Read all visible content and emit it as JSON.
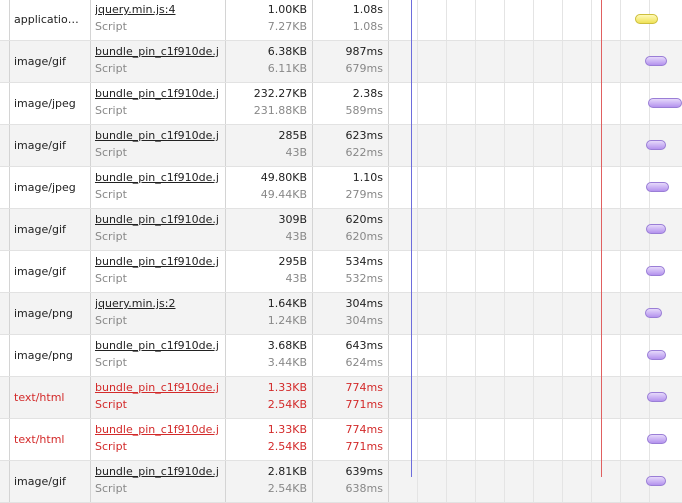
{
  "rows": [
    {
      "type": "applicatio…",
      "initiator": "jquery.min.js:4",
      "initiator_kind": "Script",
      "size": "1.00KB",
      "content": "7.27KB",
      "time": "1.08s",
      "latency": "1.08s",
      "status": "ok",
      "bar_color": "yellow"
    },
    {
      "type": "image/gif",
      "initiator": "bundle_pin_c1f910de.j",
      "initiator_kind": "Script",
      "size": "6.38KB",
      "content": "6.11KB",
      "time": "987ms",
      "latency": "679ms",
      "status": "ok",
      "bar_color": "purple"
    },
    {
      "type": "image/jpeg",
      "initiator": "bundle_pin_c1f910de.j",
      "initiator_kind": "Script",
      "size": "232.27KB",
      "content": "231.88KB",
      "time": "2.38s",
      "latency": "589ms",
      "status": "ok",
      "bar_color": "purple"
    },
    {
      "type": "image/gif",
      "initiator": "bundle_pin_c1f910de.j",
      "initiator_kind": "Script",
      "size": "285B",
      "content": "43B",
      "time": "623ms",
      "latency": "622ms",
      "status": "ok",
      "bar_color": "purple"
    },
    {
      "type": "image/jpeg",
      "initiator": "bundle_pin_c1f910de.j",
      "initiator_kind": "Script",
      "size": "49.80KB",
      "content": "49.44KB",
      "time": "1.10s",
      "latency": "279ms",
      "status": "ok",
      "bar_color": "purple"
    },
    {
      "type": "image/gif",
      "initiator": "bundle_pin_c1f910de.j",
      "initiator_kind": "Script",
      "size": "309B",
      "content": "43B",
      "time": "620ms",
      "latency": "620ms",
      "status": "ok",
      "bar_color": "purple"
    },
    {
      "type": "image/gif",
      "initiator": "bundle_pin_c1f910de.j",
      "initiator_kind": "Script",
      "size": "295B",
      "content": "43B",
      "time": "534ms",
      "latency": "532ms",
      "status": "ok",
      "bar_color": "purple"
    },
    {
      "type": "image/png",
      "initiator": "jquery.min.js:2",
      "initiator_kind": "Script",
      "size": "1.64KB",
      "content": "1.24KB",
      "time": "304ms",
      "latency": "304ms",
      "status": "ok",
      "bar_color": "purple"
    },
    {
      "type": "image/png",
      "initiator": "bundle_pin_c1f910de.j",
      "initiator_kind": "Script",
      "size": "3.68KB",
      "content": "3.44KB",
      "time": "643ms",
      "latency": "624ms",
      "status": "ok",
      "bar_color": "purple"
    },
    {
      "type": "text/html",
      "initiator": "bundle_pin_c1f910de.j",
      "initiator_kind": "Script",
      "size": "1.33KB",
      "content": "2.54KB",
      "time": "774ms",
      "latency": "771ms",
      "status": "error",
      "bar_color": "purple"
    },
    {
      "type": "text/html",
      "initiator": "bundle_pin_c1f910de.j",
      "initiator_kind": "Script",
      "size": "1.33KB",
      "content": "2.54KB",
      "time": "774ms",
      "latency": "771ms",
      "status": "error",
      "bar_color": "purple"
    },
    {
      "type": "image/gif",
      "initiator": "bundle_pin_c1f910de.j",
      "initiator_kind": "Script",
      "size": "2.81KB",
      "content": "2.54KB",
      "time": "639ms",
      "latency": "638ms",
      "status": "ok",
      "bar_color": "purple"
    }
  ],
  "colors": {
    "dom_content_loaded_line": "#6d6ddc",
    "load_line": "#e06060",
    "error_text": "#d32a2a",
    "bar_purple": "#b493ee",
    "bar_yellow": "#efe157"
  }
}
